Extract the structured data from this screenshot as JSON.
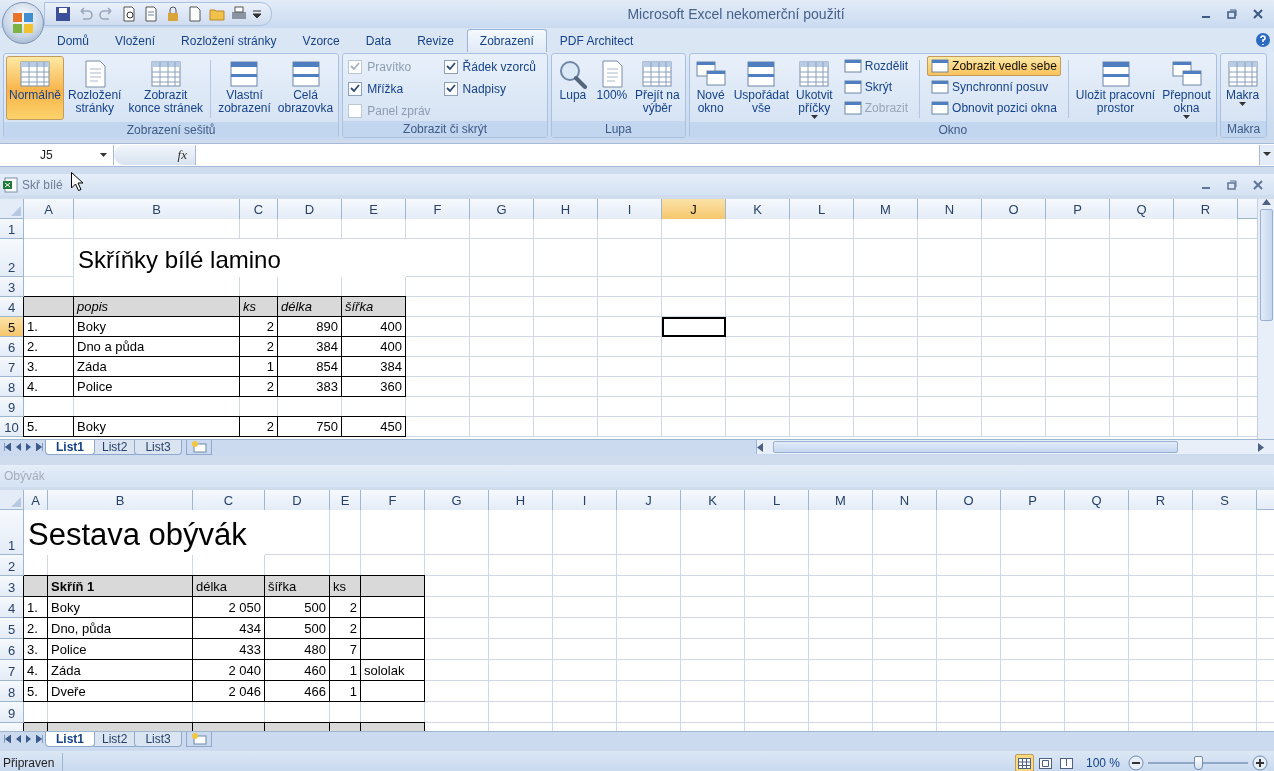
{
  "window": {
    "title": "Microsoft Excel nekomerční použití"
  },
  "ribbon_tabs": [
    {
      "label": "Domů",
      "selected": false
    },
    {
      "label": "Vložení",
      "selected": false
    },
    {
      "label": "Rozložení stránky",
      "selected": false
    },
    {
      "label": "Vzorce",
      "selected": false
    },
    {
      "label": "Data",
      "selected": false
    },
    {
      "label": "Revize",
      "selected": false
    },
    {
      "label": "Zobrazení",
      "selected": true
    },
    {
      "label": "PDF Architect",
      "selected": false
    }
  ],
  "ribbon_groups": [
    {
      "label": "Zobrazení sešitů",
      "items": [
        {
          "kind": "large",
          "lines": [
            "Normálně"
          ],
          "selected": true,
          "dropdown": false
        },
        {
          "kind": "large",
          "lines": [
            "Rozložení",
            "stránky"
          ],
          "selected": false,
          "dropdown": false
        },
        {
          "kind": "large",
          "lines": [
            "Zobrazit",
            "konce stránek"
          ],
          "selected": false,
          "dropdown": false
        },
        {
          "kind": "separator"
        },
        {
          "kind": "large",
          "lines": [
            "Vlastní",
            "zobrazení"
          ],
          "selected": false,
          "dropdown": false
        },
        {
          "kind": "large",
          "lines": [
            "Celá",
            "obrazovka"
          ],
          "selected": false,
          "dropdown": false
        }
      ]
    },
    {
      "label": "Zobrazit či skrýt",
      "items": [
        {
          "kind": "stack",
          "items": [
            {
              "kind": "checkbox",
              "label": "Pravítko",
              "checked": true,
              "disabled": true
            },
            {
              "kind": "checkbox",
              "label": "Mřížka",
              "checked": true,
              "disabled": false
            },
            {
              "kind": "checkbox",
              "label": "Panel zpráv",
              "checked": false,
              "disabled": true
            }
          ]
        },
        {
          "kind": "stack",
          "items": [
            {
              "kind": "checkbox",
              "label": "Řádek vzorců",
              "checked": true,
              "disabled": false
            },
            {
              "kind": "checkbox",
              "label": "Nadpisy",
              "checked": true,
              "disabled": false
            }
          ]
        }
      ]
    },
    {
      "label": "Lupa",
      "items": [
        {
          "kind": "large",
          "lines": [
            "Lupa"
          ],
          "selected": false,
          "dropdown": false
        },
        {
          "kind": "large",
          "lines": [
            "100%"
          ],
          "selected": false,
          "dropdown": false
        },
        {
          "kind": "large",
          "lines": [
            "Přejít na",
            "výběr"
          ],
          "selected": false,
          "dropdown": false
        }
      ]
    },
    {
      "label": "Okno",
      "items": [
        {
          "kind": "large",
          "lines": [
            "Nové",
            "okno"
          ],
          "selected": false,
          "dropdown": false
        },
        {
          "kind": "large",
          "lines": [
            "Uspořádat",
            "vše"
          ],
          "selected": false,
          "dropdown": false
        },
        {
          "kind": "large",
          "lines": [
            "Ukotvit",
            "příčky"
          ],
          "selected": false,
          "dropdown": true
        },
        {
          "kind": "stack",
          "items": [
            {
              "kind": "small",
              "label": "Rozdělit",
              "selected": false,
              "disabled": false
            },
            {
              "kind": "small",
              "label": "Skrýt",
              "selected": false,
              "disabled": false
            },
            {
              "kind": "small",
              "label": "Zobrazit",
              "selected": false,
              "disabled": true
            }
          ]
        },
        {
          "kind": "separator"
        },
        {
          "kind": "stack",
          "items": [
            {
              "kind": "small",
              "label": "Zobrazit vedle sebe",
              "selected": true,
              "disabled": false
            },
            {
              "kind": "small",
              "label": "Synchronní posuv",
              "selected": false,
              "disabled": false
            },
            {
              "kind": "small",
              "label": "Obnovit pozici okna",
              "selected": false,
              "disabled": false
            }
          ]
        },
        {
          "kind": "separator"
        },
        {
          "kind": "large",
          "lines": [
            "Uložit pracovní",
            "prostor"
          ],
          "selected": false,
          "dropdown": false
        },
        {
          "kind": "large",
          "lines": [
            "Přepnout",
            "okna"
          ],
          "selected": false,
          "dropdown": true
        }
      ]
    },
    {
      "label": "Makra",
      "items": [
        {
          "kind": "large",
          "lines": [
            "Makra"
          ],
          "selected": false,
          "dropdown": true
        }
      ]
    }
  ],
  "formula_bar": {
    "name_box": "J5",
    "function_label": "fx"
  },
  "sheets": [
    {
      "title": "Skř bílé",
      "active": true,
      "columns": [
        {
          "label": "A",
          "selected": false
        },
        {
          "label": "B",
          "selected": false
        },
        {
          "label": "C",
          "selected": false
        },
        {
          "label": "D",
          "selected": false
        },
        {
          "label": "E",
          "selected": false
        },
        {
          "label": "F",
          "selected": false
        },
        {
          "label": "G",
          "selected": false
        },
        {
          "label": "H",
          "selected": false
        },
        {
          "label": "I",
          "selected": false
        },
        {
          "label": "J",
          "selected": true
        },
        {
          "label": "K",
          "selected": false
        },
        {
          "label": "L",
          "selected": false
        },
        {
          "label": "M",
          "selected": false
        },
        {
          "label": "N",
          "selected": false
        },
        {
          "label": "O",
          "selected": false
        },
        {
          "label": "P",
          "selected": false
        },
        {
          "label": "Q",
          "selected": false
        },
        {
          "label": "R",
          "selected": false
        }
      ],
      "rows": [
        {
          "label": "1",
          "selected": false,
          "kind": "blank"
        },
        {
          "label": "2",
          "selected": false,
          "kind": "title",
          "text": "Skříňky bílé lamino"
        },
        {
          "label": "3",
          "selected": false,
          "kind": "blank"
        },
        {
          "label": "4",
          "selected": false,
          "kind": "header",
          "cells": [
            {
              "kind": "empty"
            },
            {
              "kind": "italic",
              "text": "popis"
            },
            {
              "kind": "italic",
              "text": "ks"
            },
            {
              "kind": "italic",
              "text": "délka"
            },
            {
              "kind": "italic",
              "text": "šířka"
            }
          ]
        },
        {
          "label": "5",
          "selected": true,
          "kind": "data",
          "cells": [
            {
              "kind": "text",
              "text": "1."
            },
            {
              "kind": "text",
              "text": "Boky"
            },
            {
              "kind": "number",
              "text": "2"
            },
            {
              "kind": "number",
              "text": "890"
            },
            {
              "kind": "number",
              "text": "400"
            }
          ]
        },
        {
          "label": "6",
          "selected": false,
          "kind": "data",
          "cells": [
            {
              "kind": "text",
              "text": "2."
            },
            {
              "kind": "text",
              "text": "Dno a půda"
            },
            {
              "kind": "number",
              "text": "2"
            },
            {
              "kind": "number",
              "text": "384"
            },
            {
              "kind": "number",
              "text": "400"
            }
          ]
        },
        {
          "label": "7",
          "selected": false,
          "kind": "data",
          "cells": [
            {
              "kind": "text",
              "text": "3."
            },
            {
              "kind": "text",
              "text": "Záda"
            },
            {
              "kind": "number",
              "text": "1"
            },
            {
              "kind": "number",
              "text": "854"
            },
            {
              "kind": "number",
              "text": "384"
            }
          ]
        },
        {
          "label": "8",
          "selected": false,
          "kind": "data",
          "cells": [
            {
              "kind": "text",
              "text": "4."
            },
            {
              "kind": "text",
              "text": "Police"
            },
            {
              "kind": "number",
              "text": "2"
            },
            {
              "kind": "number",
              "text": "383"
            },
            {
              "kind": "number",
              "text": "360"
            }
          ]
        },
        {
          "label": "9",
          "selected": false,
          "kind": "blank"
        },
        {
          "label": "10",
          "selected": false,
          "kind": "data",
          "cells": [
            {
              "kind": "text",
              "text": "5."
            },
            {
              "kind": "text",
              "text": "Boky"
            },
            {
              "kind": "number",
              "text": "2"
            },
            {
              "kind": "number",
              "text": "750"
            },
            {
              "kind": "number",
              "text": "450"
            }
          ]
        }
      ],
      "sheet_tabs": [
        {
          "label": "List1",
          "selected": true
        },
        {
          "label": "List2",
          "selected": false
        },
        {
          "label": "List3",
          "selected": false
        }
      ]
    },
    {
      "title": "Obývák",
      "active": false,
      "columns": [
        {
          "label": "A",
          "selected": false
        },
        {
          "label": "B",
          "selected": false
        },
        {
          "label": "C",
          "selected": false
        },
        {
          "label": "D",
          "selected": false
        },
        {
          "label": "E",
          "selected": false
        },
        {
          "label": "F",
          "selected": false
        },
        {
          "label": "G",
          "selected": false
        },
        {
          "label": "H",
          "selected": false
        },
        {
          "label": "I",
          "selected": false
        },
        {
          "label": "J",
          "selected": false
        },
        {
          "label": "K",
          "selected": false
        },
        {
          "label": "L",
          "selected": false
        },
        {
          "label": "M",
          "selected": false
        },
        {
          "label": "N",
          "selected": false
        },
        {
          "label": "O",
          "selected": false
        },
        {
          "label": "P",
          "selected": false
        },
        {
          "label": "Q",
          "selected": false
        },
        {
          "label": "R",
          "selected": false
        },
        {
          "label": "S",
          "selected": false
        }
      ],
      "rows": [
        {
          "label": "1",
          "selected": false,
          "kind": "title",
          "text": "Sestava obývák"
        },
        {
          "label": "2",
          "selected": false,
          "kind": "blank"
        },
        {
          "label": "3",
          "selected": false,
          "kind": "header",
          "cells": [
            {
              "kind": "empty"
            },
            {
              "kind": "bold",
              "text": "Skříň 1"
            },
            {
              "kind": "text",
              "text": "délka"
            },
            {
              "kind": "text",
              "text": "šířka"
            },
            {
              "kind": "text",
              "text": "ks"
            },
            {
              "kind": "empty"
            }
          ]
        },
        {
          "label": "4",
          "selected": false,
          "kind": "data",
          "cells": [
            {
              "kind": "text",
              "text": "1."
            },
            {
              "kind": "text",
              "text": "Boky"
            },
            {
              "kind": "number",
              "text": "2 050"
            },
            {
              "kind": "number",
              "text": "500"
            },
            {
              "kind": "number",
              "text": "2"
            },
            {
              "kind": "empty"
            }
          ]
        },
        {
          "label": "5",
          "selected": false,
          "kind": "data",
          "cells": [
            {
              "kind": "text",
              "text": "2."
            },
            {
              "kind": "text",
              "text": "Dno, půda"
            },
            {
              "kind": "number",
              "text": "434"
            },
            {
              "kind": "number",
              "text": "500"
            },
            {
              "kind": "number",
              "text": "2"
            },
            {
              "kind": "empty"
            }
          ]
        },
        {
          "label": "6",
          "selected": false,
          "kind": "data",
          "cells": [
            {
              "kind": "text",
              "text": "3."
            },
            {
              "kind": "text",
              "text": "Police"
            },
            {
              "kind": "number",
              "text": "433"
            },
            {
              "kind": "number",
              "text": "480"
            },
            {
              "kind": "number",
              "text": "7"
            },
            {
              "kind": "empty"
            }
          ]
        },
        {
          "label": "7",
          "selected": false,
          "kind": "data",
          "cells": [
            {
              "kind": "text",
              "text": "4."
            },
            {
              "kind": "text",
              "text": "Záda"
            },
            {
              "kind": "number",
              "text": "2 040"
            },
            {
              "kind": "number",
              "text": "460"
            },
            {
              "kind": "number",
              "text": "1"
            },
            {
              "kind": "text",
              "text": "sololak"
            }
          ]
        },
        {
          "label": "8",
          "selected": false,
          "kind": "data",
          "cells": [
            {
              "kind": "text",
              "text": "5."
            },
            {
              "kind": "text",
              "text": "Dveře"
            },
            {
              "kind": "number",
              "text": "2 046"
            },
            {
              "kind": "number",
              "text": "466"
            },
            {
              "kind": "number",
              "text": "1"
            },
            {
              "kind": "empty"
            }
          ]
        },
        {
          "label": "9",
          "selected": false,
          "kind": "blank"
        },
        {
          "selected": false,
          "kind": "header",
          "cells": [
            {
              "kind": "empty"
            },
            {
              "kind": "empty"
            },
            {
              "kind": "empty"
            },
            {
              "kind": "empty"
            },
            {
              "kind": "empty"
            },
            {
              "kind": "empty"
            }
          ]
        }
      ],
      "sheet_tabs": [
        {
          "label": "List1",
          "selected": true
        },
        {
          "label": "List2",
          "selected": false
        },
        {
          "label": "List3",
          "selected": false
        }
      ]
    }
  ],
  "status_bar": {
    "text": "Připraven",
    "views": [
      {
        "selected": true
      },
      {
        "selected": false
      },
      {
        "selected": false
      }
    ],
    "zoom": {
      "label": "100 %",
      "level": 0.5
    }
  }
}
